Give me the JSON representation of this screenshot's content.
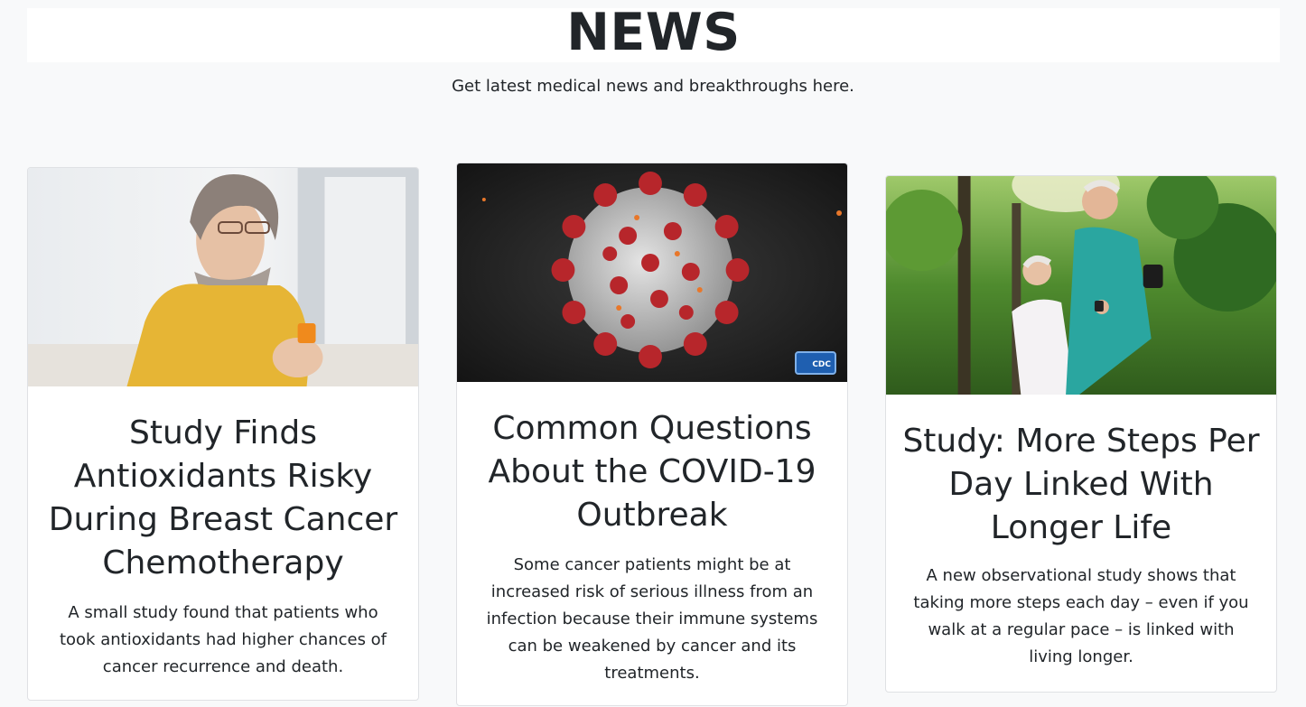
{
  "header": {
    "title": "NEWS",
    "subtitle": "Get latest medical news and breakthroughs here."
  },
  "cards": [
    {
      "image_icon": "woman-with-pill-bottle-photo",
      "title": "Study Finds Antioxidants Risky During Breast Cancer Chemotherapy",
      "text": "A small study found that patients who took antioxidants had higher chances of cancer recurrence and death."
    },
    {
      "image_icon": "coronavirus-illustration",
      "badge": "CDC",
      "title": "Common Questions About the COVID-19 Outbreak",
      "text": "Some cancer patients might be at increased risk of serious illness from an infection because their immune systems can be weakened by cancer and its treatments."
    },
    {
      "image_icon": "seniors-jogging-photo",
      "title": "Study: More Steps Per Day Linked With Longer Life",
      "text": "A new observational study shows that taking more steps each day – even if you walk at a regular pace – is linked with living longer."
    }
  ],
  "colors": {
    "page_background": "#f8f9fa",
    "card_background": "#ffffff",
    "text": "#212529",
    "border": "#dfe1e4"
  }
}
